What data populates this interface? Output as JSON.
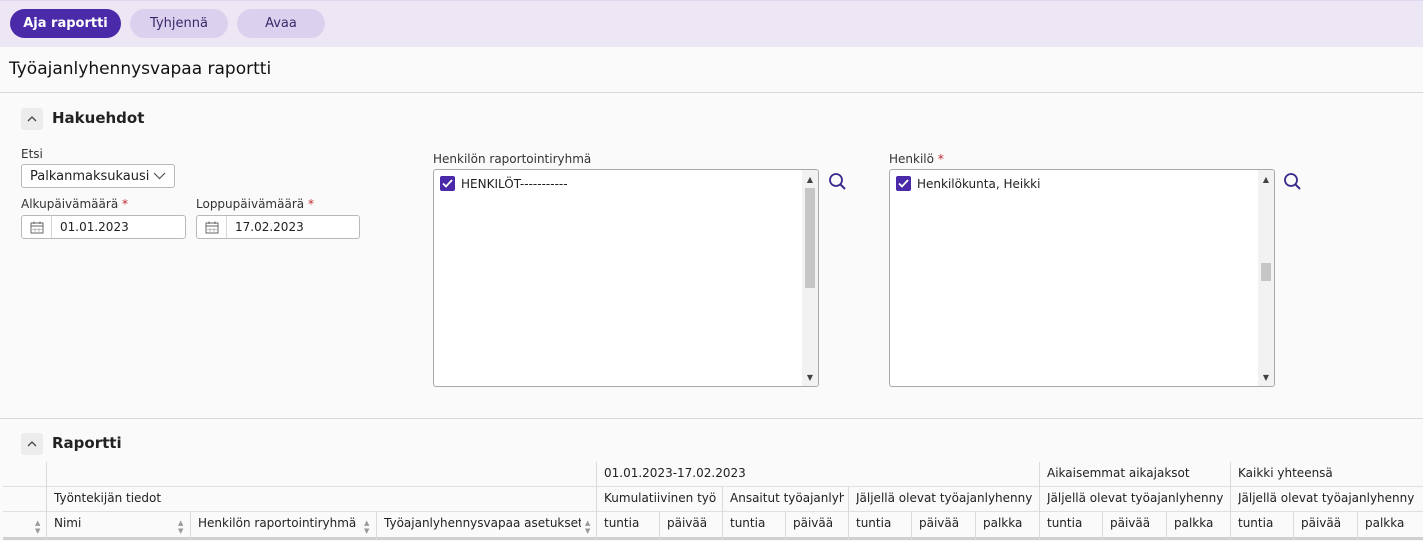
{
  "toolbar": {
    "run_label": "Aja raportti",
    "clear_label": "Tyhjennä",
    "open_label": "Avaa"
  },
  "page": {
    "title": "Työajanlyhennysvapaa raportti"
  },
  "criteria": {
    "title": "Hakuehdot",
    "search": {
      "label": "Etsi",
      "value": "Palkanmaksukausi"
    },
    "start_date": {
      "label": "Alkupäivämäärä",
      "required": "*",
      "value": "01.01.2023"
    },
    "end_date": {
      "label": "Loppupäivämäärä",
      "required": "*",
      "value": "17.02.2023"
    },
    "group": {
      "label": "Henkilön raportointiryhmä",
      "items": [
        "HENKILÖT-----------"
      ]
    },
    "person": {
      "label": "Henkilö",
      "required": "*",
      "items": [
        "Henkilökunta, Heikki"
      ]
    }
  },
  "report": {
    "title": "Raportti",
    "header_row1": {
      "period": "01.01.2023-17.02.2023",
      "previous": "Aikaisemmat aikajaksot",
      "total": "Kaikki yhteensä"
    },
    "header_row2": {
      "employee": "Työntekijän tiedot",
      "cumulative": "Kumulatiivinen työ",
      "earned": "Ansaitut työajanlyh",
      "remaining": "Jäljellä olevat työajanlyhenny",
      "prev_remaining": "Jäljellä olevat työajanlyhenny",
      "total_remaining": "Jäljellä olevat työajanlyhenny"
    },
    "columns": {
      "name": "Nimi",
      "group": "Henkilön raportointiryhmä",
      "settings": "Työajanlyhennysvapaa asetukset",
      "hours": "tuntia",
      "days": "päivää",
      "salary": "palkka"
    }
  },
  "colors": {
    "accent": "#4a2aa8",
    "toolbar_bg": "#ede6f5"
  }
}
